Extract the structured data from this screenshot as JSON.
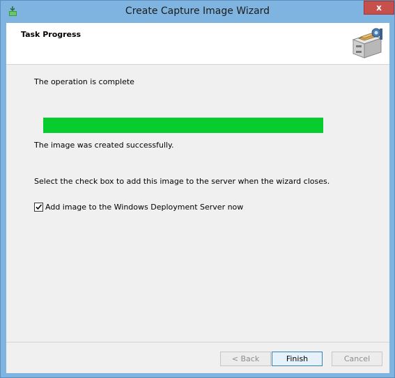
{
  "window": {
    "title": "Create Capture Image Wizard",
    "close_label": "x"
  },
  "header": {
    "title": "Task Progress"
  },
  "content": {
    "operation_status": "The operation is complete",
    "progress_percent": 100,
    "result_message": "The image was created successfully.",
    "instruction": "Select the check box to add this image to the server when the wizard closes.",
    "checkbox": {
      "label": "Add image to the Windows Deployment Server now",
      "checked": true
    }
  },
  "footer": {
    "back_label": "< Back",
    "finish_label": "Finish",
    "cancel_label": "Cancel"
  },
  "colors": {
    "progress_fill": "#06cc2d",
    "title_bar": "#7fb4e0",
    "close_button": "#c7504c"
  }
}
